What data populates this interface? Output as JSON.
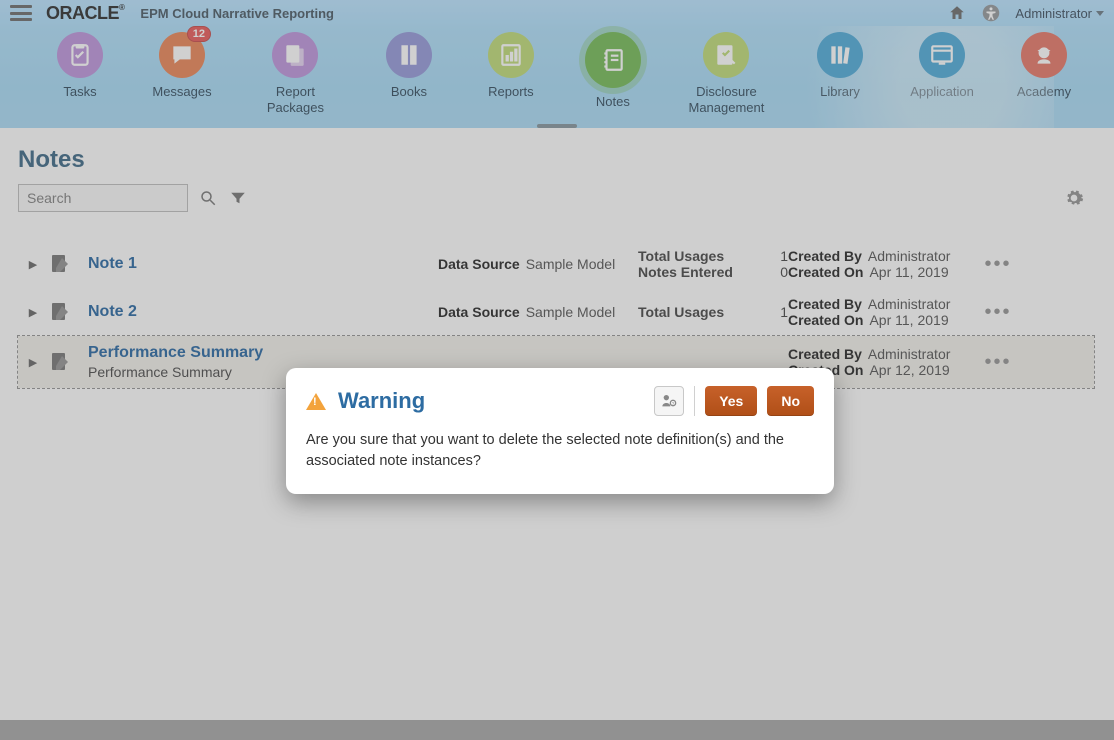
{
  "header": {
    "logo_text": "ORACLE",
    "product": "EPM Cloud Narrative Reporting",
    "user_label": "Administrator"
  },
  "nav": [
    {
      "label": "Tasks",
      "color": "#b78ad9",
      "active": false,
      "badge": null,
      "icon": "tasks"
    },
    {
      "label": "Messages",
      "color": "#e97a47",
      "active": false,
      "badge": "12",
      "icon": "messages"
    },
    {
      "label": "Report Packages",
      "color": "#b78ad9",
      "active": false,
      "badge": null,
      "icon": "report-packages"
    },
    {
      "label": "Books",
      "color": "#8a8fd6",
      "active": false,
      "badge": null,
      "icon": "books"
    },
    {
      "label": "Reports",
      "color": "#b9d86a",
      "active": false,
      "badge": null,
      "icon": "reports"
    },
    {
      "label": "Notes",
      "color": "#67b447",
      "active": true,
      "badge": null,
      "icon": "notes"
    },
    {
      "label": "Disclosure Management",
      "color": "#b9d86a",
      "active": false,
      "badge": null,
      "icon": "disclosure"
    },
    {
      "label": "Library",
      "color": "#3ea3d6",
      "active": false,
      "badge": null,
      "icon": "library"
    },
    {
      "label": "Application",
      "color": "#3ea3d6",
      "active": false,
      "badge": null,
      "icon": "application"
    },
    {
      "label": "Academy",
      "color": "#e46a5a",
      "active": false,
      "badge": null,
      "icon": "academy"
    }
  ],
  "page": {
    "title": "Notes",
    "search_placeholder": "Search",
    "labels": {
      "data_source": "Data Source",
      "total_usages": "Total Usages",
      "notes_entered": "Notes Entered",
      "created_by": "Created By",
      "created_on": "Created On"
    }
  },
  "notes": [
    {
      "title": "Note 1",
      "subtitle": "",
      "data_source": "Sample Model",
      "total_usages": "1",
      "notes_entered": "0",
      "created_by": "Administrator",
      "created_on": "Apr 11, 2019",
      "selected": false
    },
    {
      "title": "Note 2",
      "subtitle": "",
      "data_source": "Sample Model",
      "total_usages": "1",
      "notes_entered": "",
      "created_by": "Administrator",
      "created_on": "Apr 11, 2019",
      "selected": false
    },
    {
      "title": "Performance Summary",
      "subtitle": "Performance Summary",
      "data_source": "",
      "total_usages": "",
      "notes_entered": "",
      "created_by": "Administrator",
      "created_on": "Apr 12, 2019",
      "selected": true
    }
  ],
  "dialog": {
    "title": "Warning",
    "message": "Are you sure that you want to delete the selected note definition(s) and the associated note instances?",
    "yes_label": "Yes",
    "no_label": "No"
  }
}
